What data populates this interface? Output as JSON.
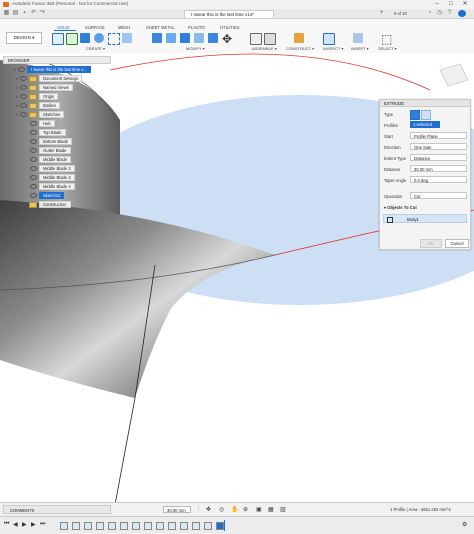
{
  "app": {
    "title": "Autodesk Fusion 360 (Personal - Not for Commercial Use)",
    "document_tab": "I swear this is the last time v14*",
    "tab_count": "6 of 10"
  },
  "ribbon": {
    "workspace": "DESIGN",
    "tabs": [
      "SOLID",
      "SURFACE",
      "MESH",
      "SHEET METAL",
      "PLASTIC",
      "UTILITIES"
    ],
    "active_tab": "SOLID",
    "groups": [
      "CREATE",
      "MODIFY",
      "ASSEMBLE",
      "CONSTRUCT",
      "INSPECT",
      "INSERT",
      "SELECT"
    ]
  },
  "browser": {
    "header": "BROWSER",
    "root": "I swear this is the last time v...",
    "items": [
      {
        "label": "Document Settings"
      },
      {
        "label": "Named Views"
      },
      {
        "label": "Origin"
      },
      {
        "label": "Bodies"
      },
      {
        "label": "Sketches"
      },
      {
        "label": "Hub"
      },
      {
        "label": "Top Blade"
      },
      {
        "label": "Bottom Blade"
      },
      {
        "label": "Outter Blade"
      },
      {
        "label": "Middle Blade"
      },
      {
        "label": "Middle Blade 2"
      },
      {
        "label": "Middle Blade 3"
      },
      {
        "label": "Middle Blade 4"
      },
      {
        "label": "Sketch12"
      },
      {
        "label": "Construction"
      }
    ]
  },
  "extrude": {
    "title": "EXTRUDE",
    "type_label": "Type",
    "profiles_label": "Profiles",
    "profiles_value": "1 selected",
    "start_label": "Start",
    "start_value": "Profile Plane",
    "direction_label": "Direction",
    "direction_value": "One Side",
    "extent_label": "Extent Type",
    "extent_value": "Distance",
    "distance_label": "Distance",
    "distance_value": "30.00 mm",
    "taper_label": "Taper Angle",
    "taper_value": "0.0 deg",
    "operation_label": "Operation",
    "operation_value": "Cut",
    "objects_label": "Objects To Cut",
    "body_value": "Body1",
    "ok": "OK",
    "cancel": "Cancel"
  },
  "status": {
    "comments": "COMMENTS",
    "distance_input": "30.00 mm",
    "profile_info": "1 Profile | Area : 4651.254 mm^2"
  },
  "colors": {
    "accent": "#1f6fd0",
    "sketch_blue": "#bcd4f0",
    "sketch_line": "#e0352b"
  }
}
